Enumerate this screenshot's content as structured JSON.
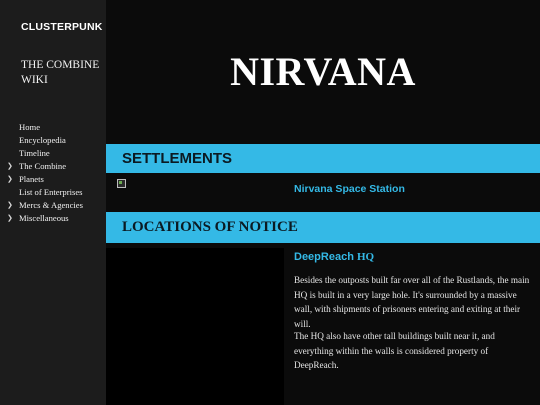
{
  "sidebar": {
    "brand": "CLUSTERPUNK",
    "wiki_title": "THE COMBINE WIKI",
    "items": [
      {
        "label": "Home",
        "has_chevron": false
      },
      {
        "label": "Encyclopedia",
        "has_chevron": false
      },
      {
        "label": "Timeline",
        "has_chevron": false
      },
      {
        "label": "The Combine",
        "has_chevron": true
      },
      {
        "label": "Planets",
        "has_chevron": true
      },
      {
        "label": "List of Enterprises",
        "has_chevron": false
      },
      {
        "label": "Mercs & Agencies",
        "has_chevron": true
      },
      {
        "label": "Miscellaneous",
        "has_chevron": true
      }
    ],
    "chevron_icon": "chevron-down-icon"
  },
  "main": {
    "title": "NIRVANA",
    "settlements": {
      "heading": "SETTLEMENTS",
      "link": "Nirvana Space Station"
    },
    "locations": {
      "heading": "LOCATIONS OF NOTICE",
      "item_name": "DeepReach",
      "item_suffix": "HQ",
      "paragraphs": [
        "Besides the outposts built far over all of the Rustlands, the main HQ is built in  a very large hole. It's surrounded by a massive wall, with shipments of prisoners entering and exiting at their will.",
        "The HQ also have other tall buildings built near it, and everything within the walls is considered property of DeepReach."
      ]
    }
  },
  "colors": {
    "accent": "#34b9e6",
    "sidebar_bg": "#1c1c1c",
    "page_bg": "#0b0b0b"
  }
}
